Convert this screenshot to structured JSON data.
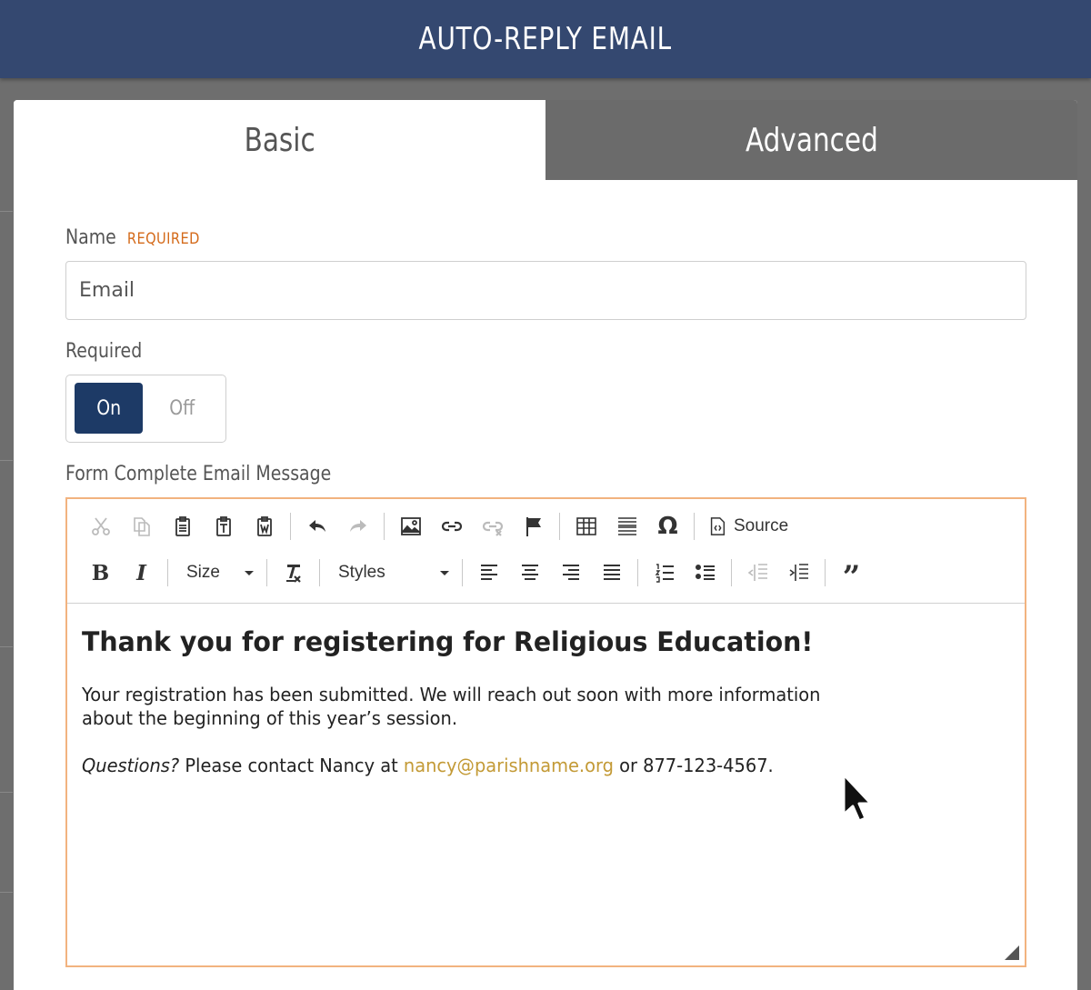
{
  "header": {
    "title": "AUTO-REPLY EMAIL"
  },
  "tabs": [
    {
      "label": "Basic",
      "active": true
    },
    {
      "label": "Advanced",
      "active": false
    }
  ],
  "name_field": {
    "label": "Name",
    "required_tag": "REQUIRED",
    "value": "Email"
  },
  "required_field": {
    "label": "Required",
    "on_label": "On",
    "off_label": "Off",
    "selected": "On"
  },
  "message_field": {
    "label": "Form Complete Email Message"
  },
  "toolbar": {
    "row1": [
      "cut",
      "copy",
      "paste",
      "paste-as-text",
      "paste-from-word",
      "undo",
      "redo",
      "image",
      "link",
      "unlink",
      "anchor",
      "table",
      "horizontal-line",
      "special-char",
      "source"
    ],
    "source_label": "Source",
    "size_label": "Size",
    "styles_label": "Styles",
    "row2": [
      "bold",
      "italic",
      "size",
      "remove-format",
      "styles",
      "align-left",
      "align-center",
      "align-right",
      "justify",
      "numbered-list",
      "bulleted-list",
      "outdent",
      "indent",
      "blockquote"
    ],
    "disabled": [
      "cut",
      "copy",
      "redo",
      "unlink",
      "outdent"
    ]
  },
  "email_body": {
    "heading": "Thank you for registering for Religious Education!",
    "paragraph1": "Your registration has been submitted. We will reach out soon with more information about the beginning of this year’s session.",
    "questions_label": "Questions?",
    "contact_text": " Please contact Nancy at ",
    "email_link": "nancy@parishname.org",
    "phone_text": " or 877-123-4567."
  },
  "colors": {
    "header_bg": "#344870",
    "toggle_on": "#1d3a66",
    "required_tag": "#d46a1a",
    "link": "#c39a36",
    "editor_border": "#f2b37f"
  }
}
